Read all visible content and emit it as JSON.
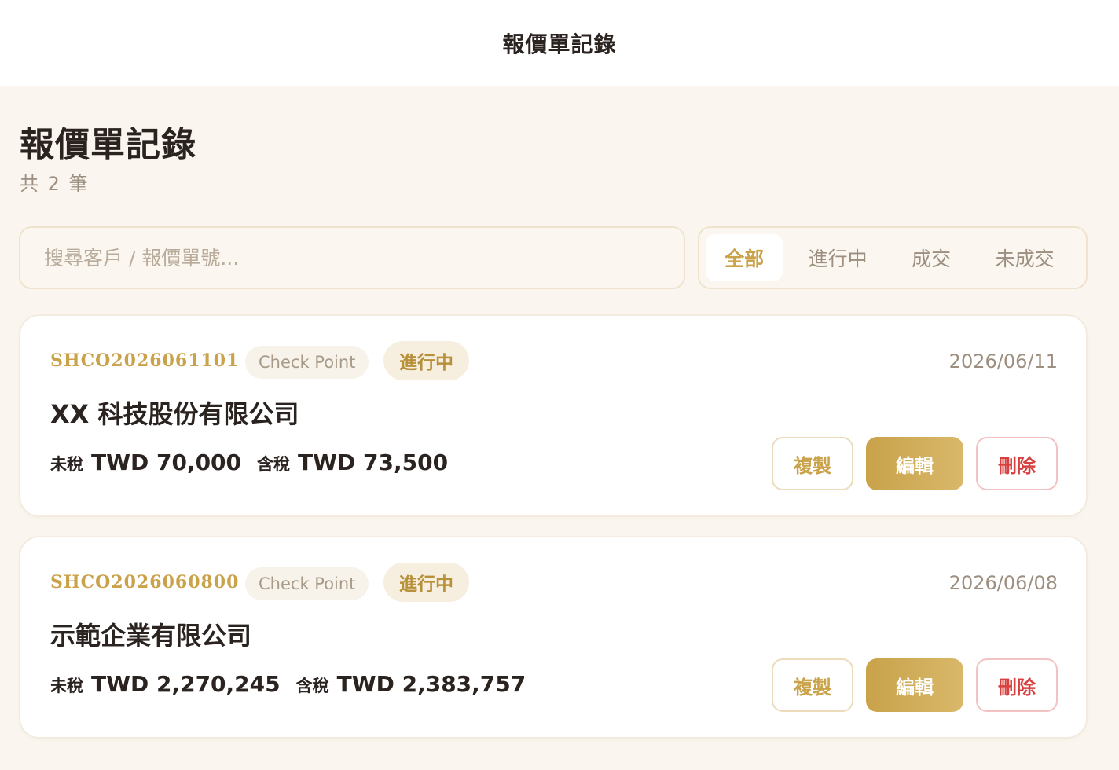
{
  "header": {
    "title": "報價單記錄"
  },
  "page": {
    "title": "報價單記錄",
    "count": "共 2 筆"
  },
  "search": {
    "placeholder": "搜尋客戶 / 報價單號...",
    "value": ""
  },
  "filters": [
    {
      "label": "全部",
      "active": true
    },
    {
      "label": "進行中",
      "active": false
    },
    {
      "label": "成交",
      "active": false
    },
    {
      "label": "未成交",
      "active": false
    }
  ],
  "quotes": [
    {
      "number": "SHCO2026061101",
      "tag": "Check Point",
      "status": "進行中",
      "date": "2026/06/11",
      "company": "XX 科技股份有限公司",
      "pretax_label": "未稅",
      "pretax": "TWD 70,000",
      "tax_label": "含稅",
      "taxed": "TWD 73,500"
    },
    {
      "number": "SHCO2026060800",
      "tag": "Check Point",
      "status": "進行中",
      "date": "2026/06/08",
      "company": "示範企業有限公司",
      "pretax_label": "未稅",
      "pretax": "TWD 2,270,245",
      "tax_label": "含稅",
      "taxed": "TWD 2,383,757"
    }
  ],
  "actions": {
    "copy": "複製",
    "edit": "編輯",
    "delete": "刪除"
  },
  "colors": {
    "accent": "#c9a24a",
    "danger": "#d84040",
    "background": "#faf6ef"
  }
}
